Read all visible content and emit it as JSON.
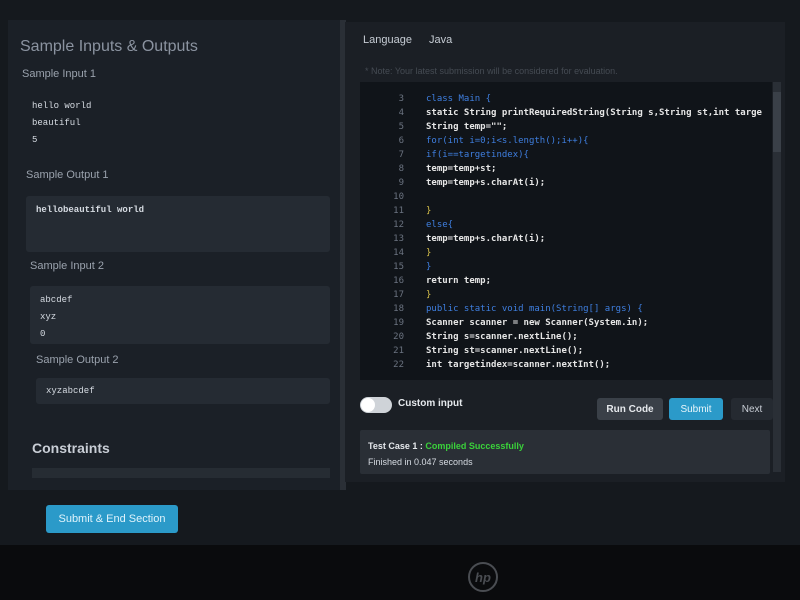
{
  "left": {
    "title": "Sample Inputs & Outputs",
    "sections": [
      {
        "label": "Sample Input 1",
        "lines": [
          "hello world",
          "beautiful",
          "5"
        ]
      },
      {
        "label": "Sample Output 1",
        "lines": [
          "hellobeautiful world"
        ]
      },
      {
        "label": "Sample Input 2",
        "lines": [
          "abcdef",
          "xyz",
          "0"
        ]
      },
      {
        "label": "Sample Output 2",
        "lines": [
          "xyzabcdef"
        ]
      }
    ],
    "constraints_title": "Constraints",
    "submit_end_label": "Submit & End Section"
  },
  "editor": {
    "language_label": "Language",
    "language_value": "Java",
    "note": "* Note: Your latest submission will be considered for evaluation.",
    "code": [
      {
        "n": "3",
        "text": "class Main {"
      },
      {
        "n": "4",
        "text": "static String printRequiredString(String s,String st,int targe"
      },
      {
        "n": "5",
        "text": "String temp=\"\";"
      },
      {
        "n": "6",
        "text": "for(int i=0;i<s.length();i++){"
      },
      {
        "n": "7",
        "text": "if(i==targetindex){"
      },
      {
        "n": "8",
        "text": "temp=temp+st;"
      },
      {
        "n": "9",
        "text": "temp=temp+s.charAt(i);"
      },
      {
        "n": "10",
        "text": ""
      },
      {
        "n": "11",
        "text": "}"
      },
      {
        "n": "12",
        "text": "else{"
      },
      {
        "n": "13",
        "text": "temp=temp+s.charAt(i);"
      },
      {
        "n": "14",
        "text": "}"
      },
      {
        "n": "15",
        "text": "}"
      },
      {
        "n": "16",
        "text": "return temp;"
      },
      {
        "n": "17",
        "text": "}"
      },
      {
        "n": "18",
        "text": "public static void main(String[] args) {"
      },
      {
        "n": "19",
        "text": "Scanner scanner = new Scanner(System.in);"
      },
      {
        "n": "20",
        "text": "String s=scanner.nextLine();"
      },
      {
        "n": "21",
        "text": "String st=scanner.nextLine();"
      },
      {
        "n": "22",
        "text": "int targetindex=scanner.nextInt();"
      }
    ],
    "custom_input_label": "Custom input",
    "run_label": "Run Code",
    "submit_label": "Submit",
    "next_label": "Next"
  },
  "result": {
    "case_label": "Test Case 1 : ",
    "status": "Compiled Successfully",
    "time": "Finished in 0.047 seconds"
  },
  "brand": {
    "logo": "hp"
  },
  "colors": {
    "accent": "#2b9ac9",
    "success": "#3ad13a"
  }
}
